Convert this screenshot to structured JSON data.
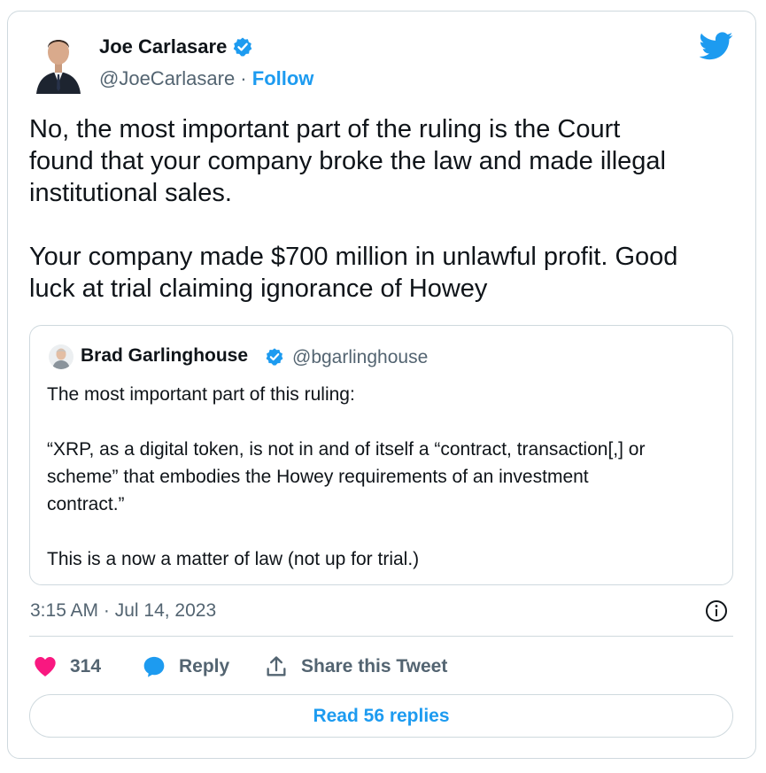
{
  "author": {
    "name": "Joe Carlasare",
    "handle": "@JoeCarlasare",
    "separator": " · ",
    "follow_label": "Follow"
  },
  "tweet": {
    "text": "No, the most important part of the ruling is the Court\nfound that your company broke the law and made illegal\ninstitutional sales.\n\nYour company made $700 million in unlawful profit. Good\nluck at trial claiming ignorance of Howey"
  },
  "quoted_tweet": {
    "name": "Brad Garlinghouse",
    "handle": "@bgarlinghouse",
    "text": "The most important part of this ruling:\n\n“XRP, as a digital token, is not in and of itself a “contract, transaction[,] or\nscheme” that embodies the Howey requirements of an investment\ncontract.”\n\nThis is a now a matter of law (not up for trial.)"
  },
  "timestamp": "3:15 AM · Jul 14, 2023",
  "actions": {
    "like_count": "314",
    "reply_label": "Reply",
    "share_label": "Share this Tweet"
  },
  "read_replies_label": "Read 56 replies",
  "icons": {
    "verified": "verified-badge-icon",
    "brand": "twitter-bird-icon",
    "info": "info-icon",
    "like": "heart-icon",
    "reply": "speech-bubble-icon",
    "share": "share-arrow-icon"
  },
  "colors": {
    "accent": "#1d9bf0",
    "like": "#f91880",
    "muted": "#536471",
    "border": "#cfd9de"
  }
}
